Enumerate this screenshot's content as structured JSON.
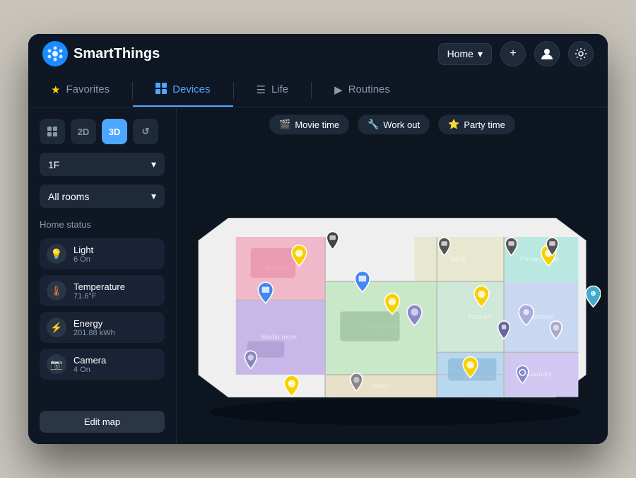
{
  "app": {
    "name": "SmartThings",
    "logo_symbol": "⚙",
    "logo_color": "#1a8cff"
  },
  "header": {
    "home_selector_label": "Home",
    "add_button_label": "+",
    "profile_icon": "👤",
    "settings_icon": "⚙"
  },
  "nav": {
    "tabs": [
      {
        "id": "favorites",
        "label": "Favorites",
        "icon": "★",
        "active": false
      },
      {
        "id": "devices",
        "label": "Devices",
        "icon": "⊞",
        "active": true
      },
      {
        "id": "life",
        "label": "Life",
        "icon": "☰",
        "active": false
      },
      {
        "id": "routines",
        "label": "Routines",
        "icon": "▶",
        "active": false
      }
    ]
  },
  "sidebar": {
    "view_controls": [
      {
        "id": "grid",
        "label": "⊞",
        "active": false
      },
      {
        "id": "2d",
        "label": "2D",
        "active": false
      },
      {
        "id": "3d",
        "label": "3D",
        "active": true
      },
      {
        "id": "history",
        "label": "↺",
        "active": false
      }
    ],
    "floor_selector": {
      "value": "1F",
      "icon": "▼"
    },
    "room_selector": {
      "value": "All rooms",
      "icon": "▼"
    },
    "home_status_title": "Home status",
    "status_items": [
      {
        "id": "light",
        "icon": "💡",
        "label": "Light",
        "value": "6 On",
        "type": "light"
      },
      {
        "id": "temperature",
        "icon": "🌡",
        "label": "Temperature",
        "value": "71.6°F",
        "type": "temp"
      },
      {
        "id": "energy",
        "icon": "⚡",
        "label": "Energy",
        "value": "201.88 kWh",
        "type": "energy"
      },
      {
        "id": "camera",
        "icon": "📷",
        "label": "Camera",
        "value": "4 On",
        "type": "camera"
      }
    ],
    "edit_map_label": "Edit map"
  },
  "quick_modes": [
    {
      "id": "movie_time",
      "icon": "🎬",
      "label": "Movie time"
    },
    {
      "id": "work_out",
      "icon": "🔧",
      "label": "Work out"
    },
    {
      "id": "party_time",
      "icon": "⭐",
      "label": "Party time"
    }
  ],
  "colors": {
    "background": "#0f1624",
    "sidebar_bg": "#0f1624",
    "card_bg": "#1a2235",
    "accent": "#4da6ff",
    "active_tab": "#4da6ff",
    "text_primary": "#ffffff",
    "text_secondary": "#8899aa"
  }
}
